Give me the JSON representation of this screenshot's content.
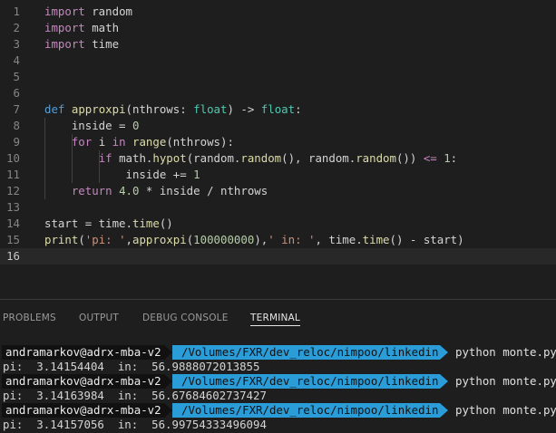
{
  "editor": {
    "line_numbers": [
      "1",
      "2",
      "3",
      "4",
      "5",
      "6",
      "7",
      "8",
      "9",
      "10",
      "11",
      "12",
      "13",
      "14",
      "15",
      "16"
    ],
    "active_line": "16",
    "code_lines": [
      [
        {
          "t": "import",
          "c": "kw"
        },
        {
          "t": " random",
          "c": "plain"
        }
      ],
      [
        {
          "t": "import",
          "c": "kw"
        },
        {
          "t": " math",
          "c": "plain"
        }
      ],
      [
        {
          "t": "import",
          "c": "kw"
        },
        {
          "t": " time",
          "c": "plain"
        }
      ],
      [],
      [],
      [],
      [
        {
          "t": "def",
          "c": "def"
        },
        {
          "t": " ",
          "c": "plain"
        },
        {
          "t": "approxpi",
          "c": "fn"
        },
        {
          "t": "(nthrows: ",
          "c": "plain"
        },
        {
          "t": "float",
          "c": "type"
        },
        {
          "t": ") -> ",
          "c": "plain"
        },
        {
          "t": "float",
          "c": "type"
        },
        {
          "t": ":",
          "c": "plain"
        }
      ],
      [
        {
          "t": "    inside = ",
          "c": "plain"
        },
        {
          "t": "0",
          "c": "num"
        }
      ],
      [
        {
          "t": "    ",
          "c": "plain"
        },
        {
          "t": "for",
          "c": "kw"
        },
        {
          "t": " i ",
          "c": "plain"
        },
        {
          "t": "in",
          "c": "kw"
        },
        {
          "t": " ",
          "c": "plain"
        },
        {
          "t": "range",
          "c": "fn"
        },
        {
          "t": "(nthrows):",
          "c": "plain"
        }
      ],
      [
        {
          "t": "        ",
          "c": "plain"
        },
        {
          "t": "if",
          "c": "kw"
        },
        {
          "t": " math.",
          "c": "plain"
        },
        {
          "t": "hypot",
          "c": "fn"
        },
        {
          "t": "(random.",
          "c": "plain"
        },
        {
          "t": "random",
          "c": "fn"
        },
        {
          "t": "(), random.",
          "c": "plain"
        },
        {
          "t": "random",
          "c": "fn"
        },
        {
          "t": "()) ",
          "c": "plain"
        },
        {
          "t": "<=",
          "c": "kw"
        },
        {
          "t": " ",
          "c": "plain"
        },
        {
          "t": "1",
          "c": "num"
        },
        {
          "t": ":",
          "c": "plain"
        }
      ],
      [
        {
          "t": "            inside += ",
          "c": "plain"
        },
        {
          "t": "1",
          "c": "num"
        }
      ],
      [
        {
          "t": "    ",
          "c": "plain"
        },
        {
          "t": "return",
          "c": "kw"
        },
        {
          "t": " ",
          "c": "plain"
        },
        {
          "t": "4.0",
          "c": "num"
        },
        {
          "t": " * inside / nthrows",
          "c": "plain"
        }
      ],
      [],
      [
        {
          "t": "start = time.",
          "c": "plain"
        },
        {
          "t": "time",
          "c": "fn"
        },
        {
          "t": "()",
          "c": "plain"
        }
      ],
      [
        {
          "t": "print",
          "c": "fn"
        },
        {
          "t": "(",
          "c": "plain"
        },
        {
          "t": "'pi: '",
          "c": "str"
        },
        {
          "t": ",",
          "c": "plain"
        },
        {
          "t": "approxpi",
          "c": "fn"
        },
        {
          "t": "(",
          "c": "plain"
        },
        {
          "t": "100000000",
          "c": "num"
        },
        {
          "t": "),",
          "c": "plain"
        },
        {
          "t": "' in: '",
          "c": "str"
        },
        {
          "t": ", time.",
          "c": "plain"
        },
        {
          "t": "time",
          "c": "fn"
        },
        {
          "t": "() - start)",
          "c": "plain"
        }
      ],
      []
    ]
  },
  "panel": {
    "tabs": [
      {
        "label": "PROBLEMS",
        "active": false
      },
      {
        "label": "OUTPUT",
        "active": false
      },
      {
        "label": "DEBUG CONSOLE",
        "active": false
      },
      {
        "label": "TERMINAL",
        "active": true
      }
    ]
  },
  "terminal": {
    "prompt_user": "andramarkov@adrx-mba-v2",
    "prompt_path": "/Volumes/FXR/dev_reloc/nimpoo/linkedin",
    "command": "python monte.py",
    "runs": [
      {
        "output": "pi:  3.14154404  in:  56.9888072013855"
      },
      {
        "output": "pi:  3.14163984  in:  56.67684602737427"
      },
      {
        "output": "pi:  3.14157056  in:  56.99754333496094"
      }
    ]
  },
  "colors": {
    "editor_bg": "#1e1e1e",
    "keyword": "#c586c0",
    "function": "#dcdcaa",
    "string": "#ce9178",
    "number": "#b5cea8",
    "type": "#4ec9b0",
    "prompt_path_bg": "#2a9cd8"
  }
}
